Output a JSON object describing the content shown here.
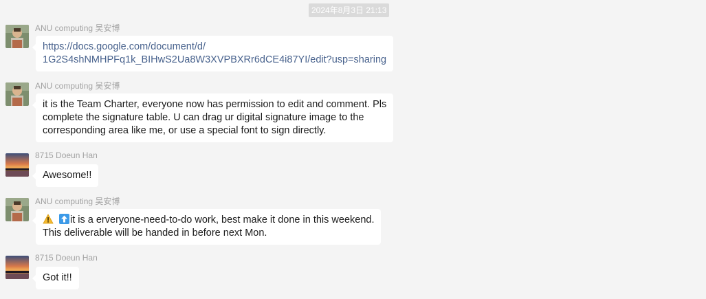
{
  "chat": {
    "timestamp": "2024年8月3日 21:13",
    "messages": [
      {
        "sender": "ANU computing 吴安博",
        "avatar_icon": "child-photo-avatar",
        "lines": [
          "https://docs.google.com/document/d/",
          "1G2S4shNMHPFq1k_BIHwS2Ua8W3XVPBXRr6dCE4i87YI/edit?usp=sharing"
        ],
        "is_link": true
      },
      {
        "sender": "ANU computing 吴安博",
        "avatar_icon": "child-photo-avatar",
        "lines": [
          "it is the Team Charter, everyone now has permission to edit and comment. Pls",
          "complete the signature table. U can drag ur digital signature image to the",
          "corresponding area like me, or use a special font to sign directly."
        ]
      },
      {
        "sender": "8715 Doeun Han",
        "avatar_icon": "sunset-photo-avatar",
        "lines": [
          "Awesome!!"
        ]
      },
      {
        "sender": "ANU computing 吴安博",
        "avatar_icon": "child-photo-avatar",
        "emoji": [
          "warning-emoji",
          "up-arrow-emoji"
        ],
        "lines": [
          "it is a erveryone-need-to-do work, best make it done in this weekend.",
          "This deliverable will be handed in before next Mon."
        ]
      },
      {
        "sender": "8715 Doeun Han",
        "avatar_icon": "sunset-photo-avatar",
        "lines": [
          "Got it!!"
        ]
      }
    ]
  },
  "colors": {
    "background": "#f4f4f4",
    "bubble": "#ffffff",
    "link": "#48628d",
    "sender": "#a2a2a2",
    "timestamp_bg": "#dadada"
  }
}
